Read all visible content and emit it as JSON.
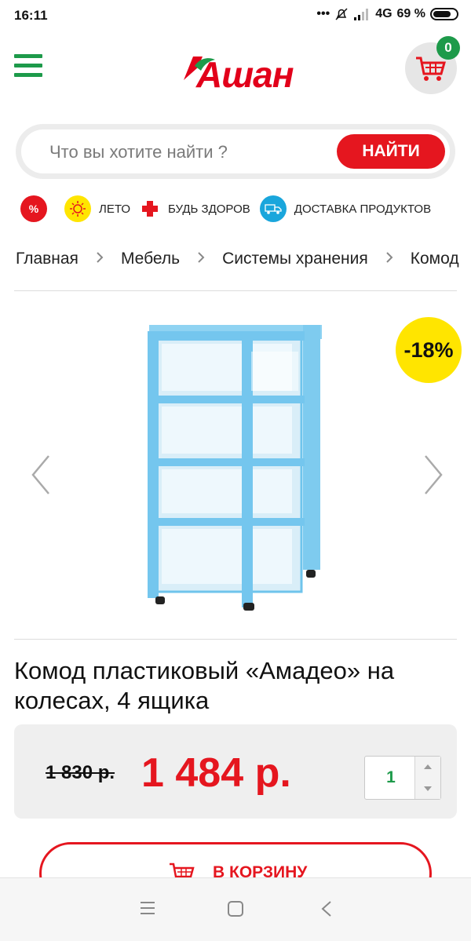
{
  "status_bar": {
    "time": "16:11",
    "dots": "•••",
    "network": "4G",
    "battery": "69 %",
    "battery_level": 0.69
  },
  "header": {
    "logo_text": "Ашан",
    "cart_count": "0",
    "colors": {
      "brand_green": "#1d9a4a",
      "brand_red": "#e2001a"
    }
  },
  "search": {
    "placeholder": "Что вы хотите найти ?",
    "button_label": "НАЙТИ"
  },
  "categories": [
    {
      "icon": "percent-icon",
      "label": ""
    },
    {
      "icon": "sun-icon",
      "label": "ЛЕТО"
    },
    {
      "icon": "medical-cross-icon",
      "label": "БУДЬ ЗДОРОВ"
    },
    {
      "icon": "delivery-truck-icon",
      "label": "ДОСТАВКА ПРОДУКТОВ"
    }
  ],
  "breadcrumb": [
    "Главная",
    "Мебель",
    "Системы хранения",
    "Комод"
  ],
  "product": {
    "discount_badge": "-18%",
    "title": "Комод пластиковый «Амадео» на колесах, 4 ящика",
    "old_price": "1 830 р.",
    "price": "1 484 р.",
    "quantity": "1",
    "add_to_cart_label": "В КОРЗИНУ"
  }
}
